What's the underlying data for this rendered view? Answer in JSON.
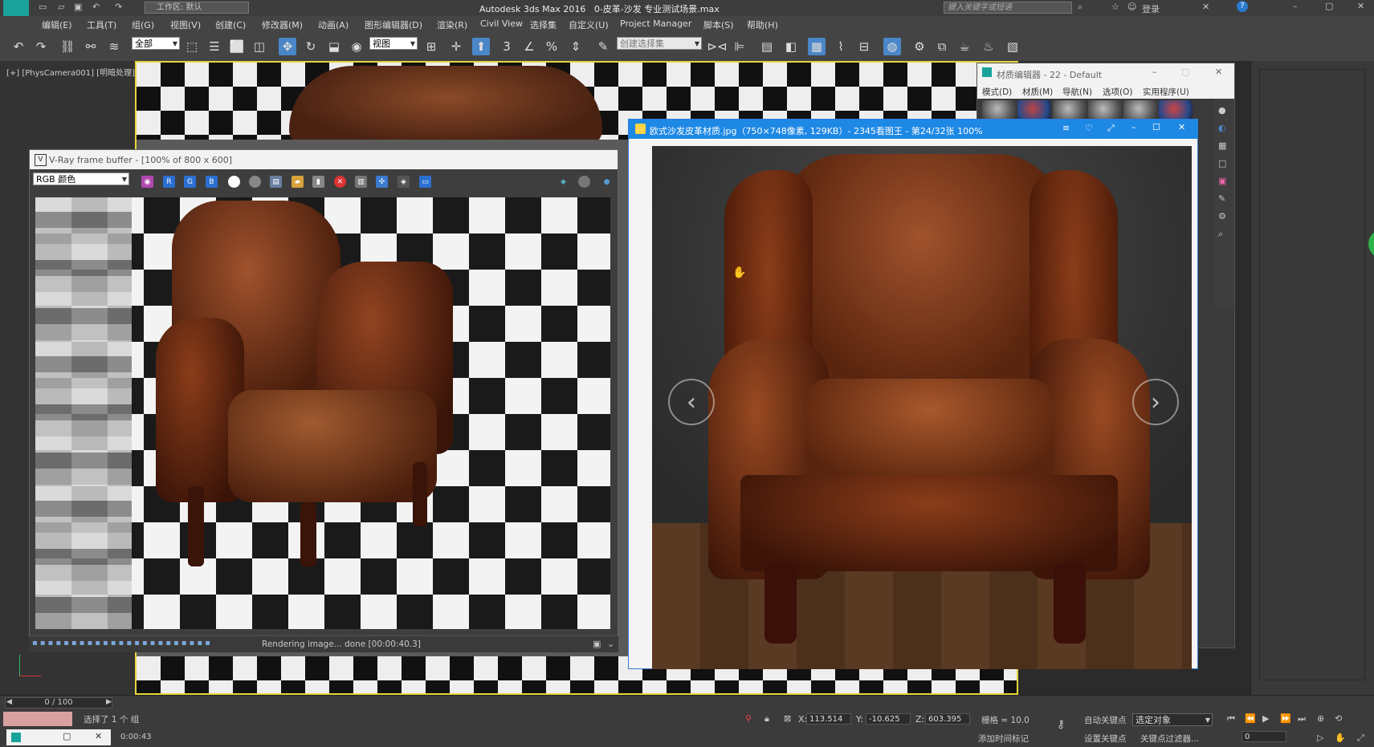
{
  "app": {
    "title": "Autodesk 3ds Max 2016",
    "file": "0-皮革-沙发 专业测试场景.max",
    "workspace": "工作区: 默认",
    "search_placeholder": "键入关键字或短语",
    "login": "登录"
  },
  "menu": [
    "编辑(E)",
    "工具(T)",
    "组(G)",
    "视图(V)",
    "创建(C)",
    "修改器(M)",
    "动画(A)",
    "图形编辑器(D)",
    "渲染(R)",
    "Civil View",
    "自定义(U)",
    "Project Manager",
    "脚本(S)",
    "帮助(H)"
  ],
  "menu_extra": "选择集",
  "toolbar": {
    "selection_filter": "全部",
    "ref_coord": "视图",
    "named_selection": "创建选择集"
  },
  "viewport": {
    "label": "[+] [PhysCamera001] [明暗处理]"
  },
  "vfb": {
    "title": "V-Ray frame buffer - [100% of 800 x 600]",
    "channel": "RGB 颜色",
    "status": "Rendering image... done [00:00:40.3]"
  },
  "viewer": {
    "title": "欧式沙发皮革材质.jpg（750×748像素, 129KB）- 2345看图王 - 第24/32张 100%"
  },
  "material_editor": {
    "title": "材质编辑器 - 22 - Default",
    "menu": [
      "模式(D)",
      "材质(M)",
      "导航(N)",
      "选项(O)",
      "实用程序(U)"
    ]
  },
  "timeline": {
    "frame": "0 / 100"
  },
  "status": {
    "selection": "选择了 1 个 组",
    "time": "0:00:43",
    "x_label": "X:",
    "x": "113.514",
    "y_label": "Y:",
    "y": "-10.625",
    "z_label": "Z:",
    "z": "603.395",
    "grid": "栅格 = 10.0",
    "auto_key": "自动关键点",
    "selected": "选定对象",
    "set_key": "设置关键点",
    "key_filter": "关键点过滤器...",
    "add_time_tag": "添加时间标记",
    "frame_field": "0"
  },
  "colors": {
    "accent": "#1e88e5",
    "viewport_border": "#e6d63a",
    "active_button": "#4a86c8"
  }
}
